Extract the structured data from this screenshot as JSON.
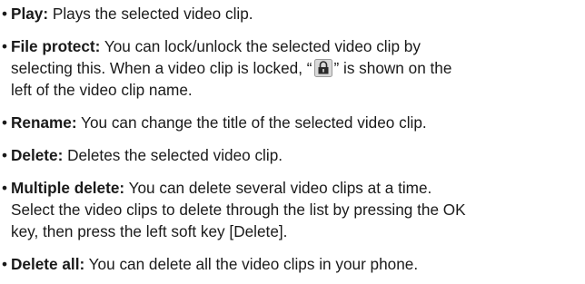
{
  "items": [
    {
      "term": "Play:",
      "lines": [
        " Plays the selected video clip."
      ]
    },
    {
      "term": "File protect:",
      "lines": [
        " You can lock/unlock the selected video clip by",
        "selecting this. When a video clip is locked, “",
        "” is shown on the",
        "left of the video clip name."
      ]
    },
    {
      "term": "Rename:",
      "lines": [
        " You can change the title of the selected video clip."
      ]
    },
    {
      "term": "Delete:",
      "lines": [
        " Deletes the selected video clip."
      ]
    },
    {
      "term": "Multiple delete:",
      "lines": [
        " You can delete several video clips at a time.",
        "Select the video clips to delete through the list by pressing the OK",
        "key, then press the left soft key [Delete]."
      ]
    },
    {
      "term": "Delete all:",
      "lines": [
        " You can delete all the video clips in your phone."
      ]
    }
  ],
  "bullet_char": "•",
  "icons": {
    "lock": "lock-icon"
  }
}
